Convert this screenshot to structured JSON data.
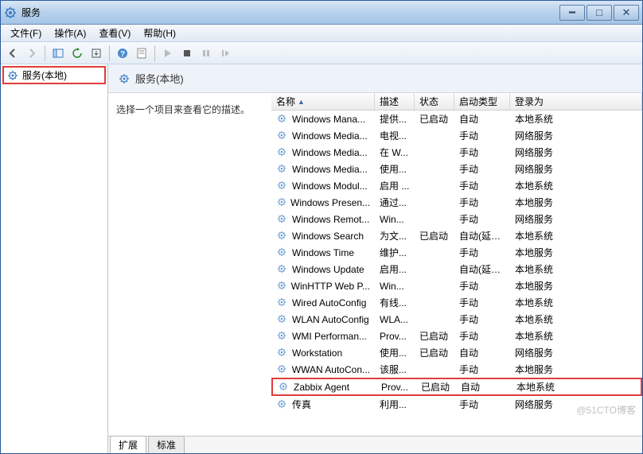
{
  "window": {
    "title": "服务"
  },
  "menu": {
    "file": "文件(F)",
    "action": "操作(A)",
    "view": "查看(V)",
    "help": "帮助(H)"
  },
  "tree": {
    "root": "服务(本地)"
  },
  "detail": {
    "title": "服务(本地)",
    "hint": "选择一个项目来查看它的描述。"
  },
  "columns": {
    "name": "名称",
    "desc": "描述",
    "status": "状态",
    "startup": "启动类型",
    "logon": "登录为"
  },
  "tabs": {
    "extended": "扩展",
    "standard": "标准"
  },
  "watermark": "@51CTO博客",
  "rows": [
    {
      "name": "Windows Mana...",
      "desc": "提供...",
      "status": "已启动",
      "startup": "自动",
      "logon": "本地系统",
      "hl": false
    },
    {
      "name": "Windows Media...",
      "desc": "电视...",
      "status": "",
      "startup": "手动",
      "logon": "网络服务",
      "hl": false
    },
    {
      "name": "Windows Media...",
      "desc": "在 W...",
      "status": "",
      "startup": "手动",
      "logon": "网络服务",
      "hl": false
    },
    {
      "name": "Windows Media...",
      "desc": "使用...",
      "status": "",
      "startup": "手动",
      "logon": "网络服务",
      "hl": false
    },
    {
      "name": "Windows Modul...",
      "desc": "启用 ...",
      "status": "",
      "startup": "手动",
      "logon": "本地系统",
      "hl": false
    },
    {
      "name": "Windows Presen...",
      "desc": "通过...",
      "status": "",
      "startup": "手动",
      "logon": "本地服务",
      "hl": false
    },
    {
      "name": "Windows Remot...",
      "desc": "Win...",
      "status": "",
      "startup": "手动",
      "logon": "网络服务",
      "hl": false
    },
    {
      "name": "Windows Search",
      "desc": "为文...",
      "status": "已启动",
      "startup": "自动(延迟...",
      "logon": "本地系统",
      "hl": false
    },
    {
      "name": "Windows Time",
      "desc": "维护...",
      "status": "",
      "startup": "手动",
      "logon": "本地服务",
      "hl": false
    },
    {
      "name": "Windows Update",
      "desc": "启用...",
      "status": "",
      "startup": "自动(延迟...",
      "logon": "本地系统",
      "hl": false
    },
    {
      "name": "WinHTTP Web P...",
      "desc": "Win...",
      "status": "",
      "startup": "手动",
      "logon": "本地服务",
      "hl": false
    },
    {
      "name": "Wired AutoConfig",
      "desc": "有线...",
      "status": "",
      "startup": "手动",
      "logon": "本地系统",
      "hl": false
    },
    {
      "name": "WLAN AutoConfig",
      "desc": "WLA...",
      "status": "",
      "startup": "手动",
      "logon": "本地系统",
      "hl": false
    },
    {
      "name": "WMI Performan...",
      "desc": "Prov...",
      "status": "已启动",
      "startup": "手动",
      "logon": "本地系统",
      "hl": false
    },
    {
      "name": "Workstation",
      "desc": "使用...",
      "status": "已启动",
      "startup": "自动",
      "logon": "网络服务",
      "hl": false
    },
    {
      "name": "WWAN AutoCon...",
      "desc": "该服...",
      "status": "",
      "startup": "手动",
      "logon": "本地服务",
      "hl": false
    },
    {
      "name": "Zabbix Agent",
      "desc": "Prov...",
      "status": "已启动",
      "startup": "自动",
      "logon": "本地系统",
      "hl": true
    },
    {
      "name": "传真",
      "desc": "利用...",
      "status": "",
      "startup": "手动",
      "logon": "网络服务",
      "hl": false
    }
  ]
}
